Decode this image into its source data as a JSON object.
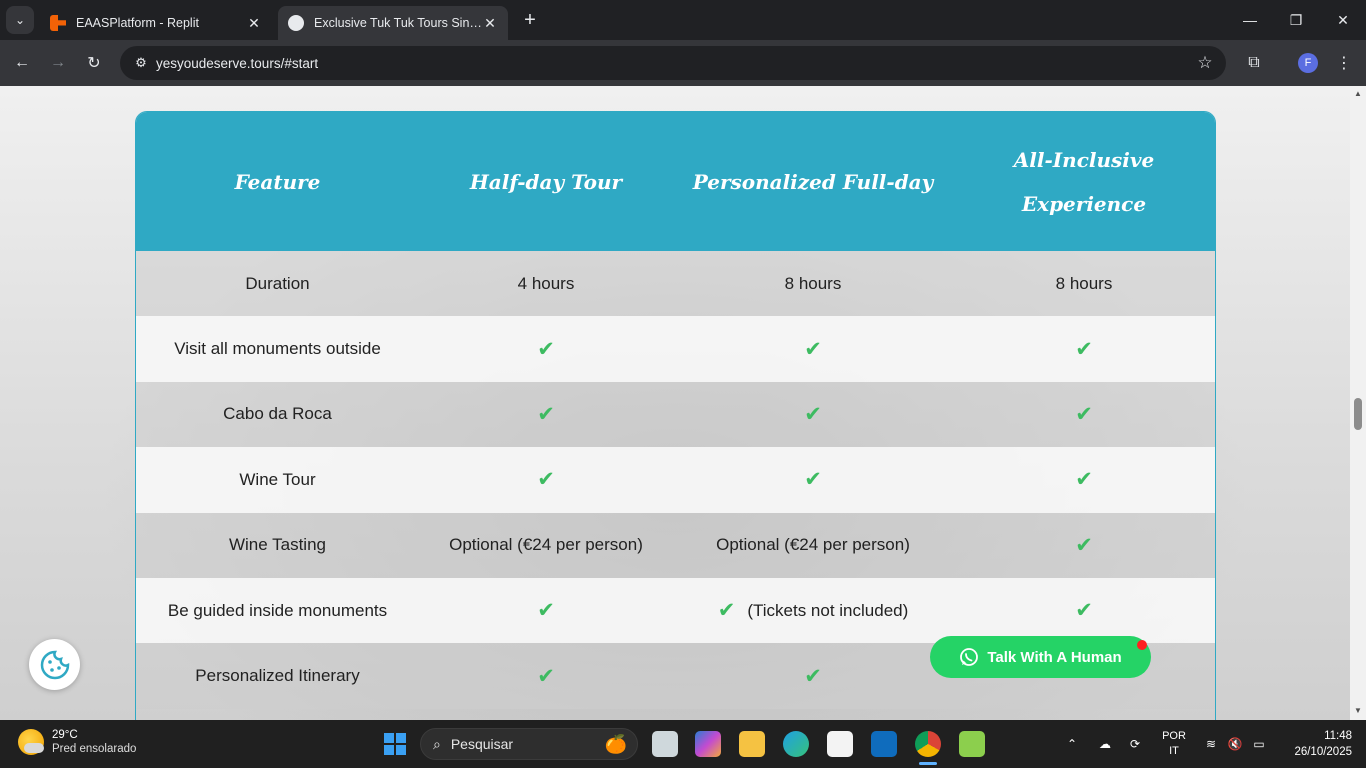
{
  "browser": {
    "tabs": [
      {
        "title": "EAASPlatform - Replit",
        "active": false
      },
      {
        "title": "Exclusive Tuk Tuk Tours Sintra & Lisbon",
        "active": true
      }
    ],
    "url": "yesyoudeserve.tours/#start",
    "profile_initial": "F"
  },
  "pricing_table": {
    "headers": [
      "Feature",
      "Half-day Tour",
      "Personalized Full-day",
      "All-Inclusive Experience"
    ],
    "rows": [
      {
        "feature": "Duration",
        "half": "4 hours",
        "full": "8 hours",
        "all": "8 hours"
      },
      {
        "feature": "Visit all monuments outside",
        "half": "✔",
        "full": "✔",
        "all": "✔"
      },
      {
        "feature": "Cabo da Roca",
        "half": "✔",
        "full": "✔",
        "all": "✔"
      },
      {
        "feature": "Wine Tour",
        "half": "✔",
        "full": "✔",
        "all": "✔"
      },
      {
        "feature": "Wine Tasting",
        "half": "Optional (€24 per person)",
        "full": "Optional (€24 per person)",
        "all": "✔"
      },
      {
        "feature": "Be guided inside monuments",
        "half": "✔",
        "full_check": "✔",
        "full_note": "(Tickets not included)",
        "all": "✔"
      },
      {
        "feature": "Personalized Itinerary",
        "half": "✔",
        "full": "✔",
        "all": ""
      }
    ]
  },
  "floating": {
    "talk_button": "Talk With A Human"
  },
  "taskbar": {
    "weather_temp": "29°C",
    "weather_desc": "Pred ensolarado",
    "search_placeholder": "Pesquisar",
    "lang_1": "POR",
    "lang_2": "IT",
    "time": "11:48",
    "date": "26/10/2025"
  },
  "colors": {
    "header_bg": "#2fa9c4",
    "check": "#3dbb61",
    "talk_button": "#25d366"
  }
}
